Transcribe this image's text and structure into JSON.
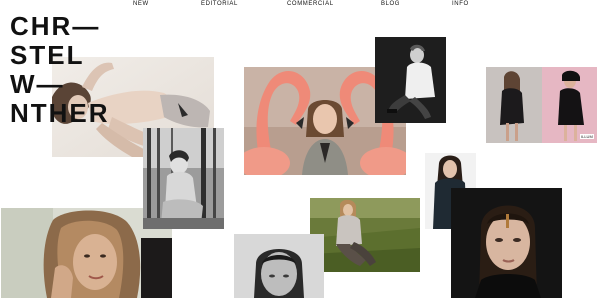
{
  "nav": {
    "items": [
      {
        "label": "NEW"
      },
      {
        "label": "EDITORIAL"
      },
      {
        "label": "COMMERCIAL"
      },
      {
        "label": "BLOG"
      },
      {
        "label": "INFO"
      }
    ]
  },
  "logo": {
    "lines": [
      "CHR—",
      "STEL",
      "W—",
      "NTHER"
    ]
  },
  "photos": {
    "pink_collage_badge": "ILLUM"
  }
}
